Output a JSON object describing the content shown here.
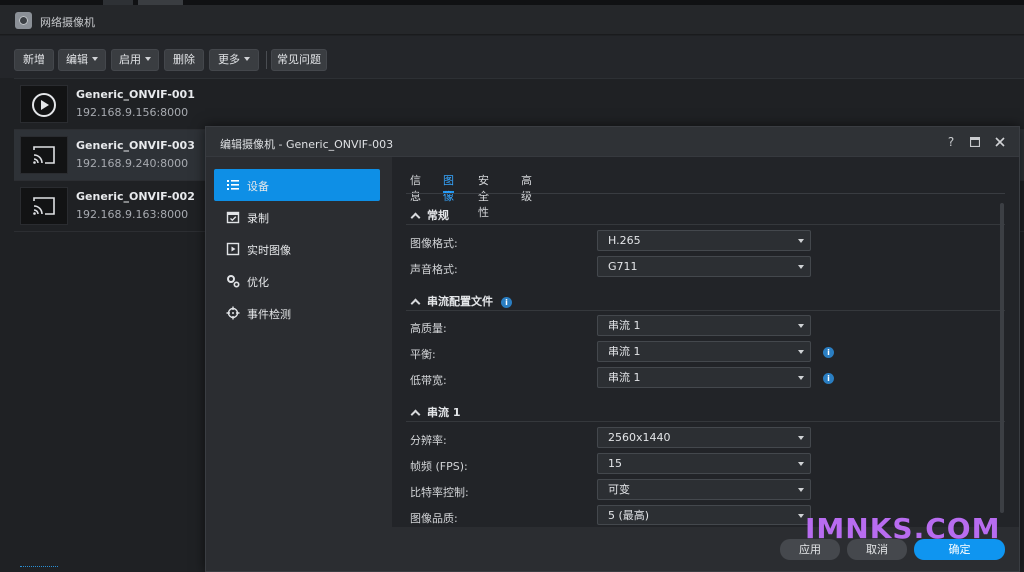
{
  "app": {
    "title": "网络摄像机"
  },
  "toolbar": {
    "add": "新增",
    "edit": "编辑",
    "enable": "启用",
    "delete": "删除",
    "more": "更多",
    "faq": "常见问题"
  },
  "cameras": [
    {
      "name": "Generic_ONVIF-001",
      "ip": "192.168.9.156:8000",
      "icon": "play-circle-icon"
    },
    {
      "name": "Generic_ONVIF-003",
      "ip": "192.168.9.240:8000",
      "icon": "cast-icon"
    },
    {
      "name": "Generic_ONVIF-002",
      "ip": "192.168.9.163:8000",
      "icon": "cast-icon"
    }
  ],
  "dialog": {
    "title": "编辑摄像机 - Generic_ONVIF-003",
    "help": "?",
    "nav": [
      {
        "label": "设备",
        "icon": "list-icon"
      },
      {
        "label": "录制",
        "icon": "calendar-check-icon"
      },
      {
        "label": "实时图像",
        "icon": "play-square-icon"
      },
      {
        "label": "优化",
        "icon": "gears-icon"
      },
      {
        "label": "事件检测",
        "icon": "crosshair-icon"
      }
    ],
    "tabs": [
      "信息",
      "图像",
      "安全性",
      "高级"
    ],
    "sections": {
      "general": "常规",
      "stream_profile": "串流配置文件",
      "stream1": "串流 1"
    },
    "fields": {
      "image_format": {
        "label": "图像格式:",
        "value": "H.265"
      },
      "audio_format": {
        "label": "声音格式:",
        "value": "G711"
      },
      "high_quality": {
        "label": "高质量:",
        "value": "串流 1"
      },
      "balanced": {
        "label": "平衡:",
        "value": "串流 1"
      },
      "low_bandwidth": {
        "label": "低带宽:",
        "value": "串流 1"
      },
      "resolution": {
        "label": "分辨率:",
        "value": "2560x1440"
      },
      "fps": {
        "label": "帧频 (FPS):",
        "value": "15"
      },
      "bitrate_control": {
        "label": "比特率控制:",
        "value": "可变"
      },
      "image_quality": {
        "label": "图像品质:",
        "value": "5 (最高)"
      }
    },
    "footer": {
      "apply": "应用",
      "cancel": "取消",
      "ok": "确定"
    }
  },
  "watermark": "IMNKS.COM",
  "colors": {
    "accent": "#0f95f0",
    "watermark": "#b86cf0"
  }
}
